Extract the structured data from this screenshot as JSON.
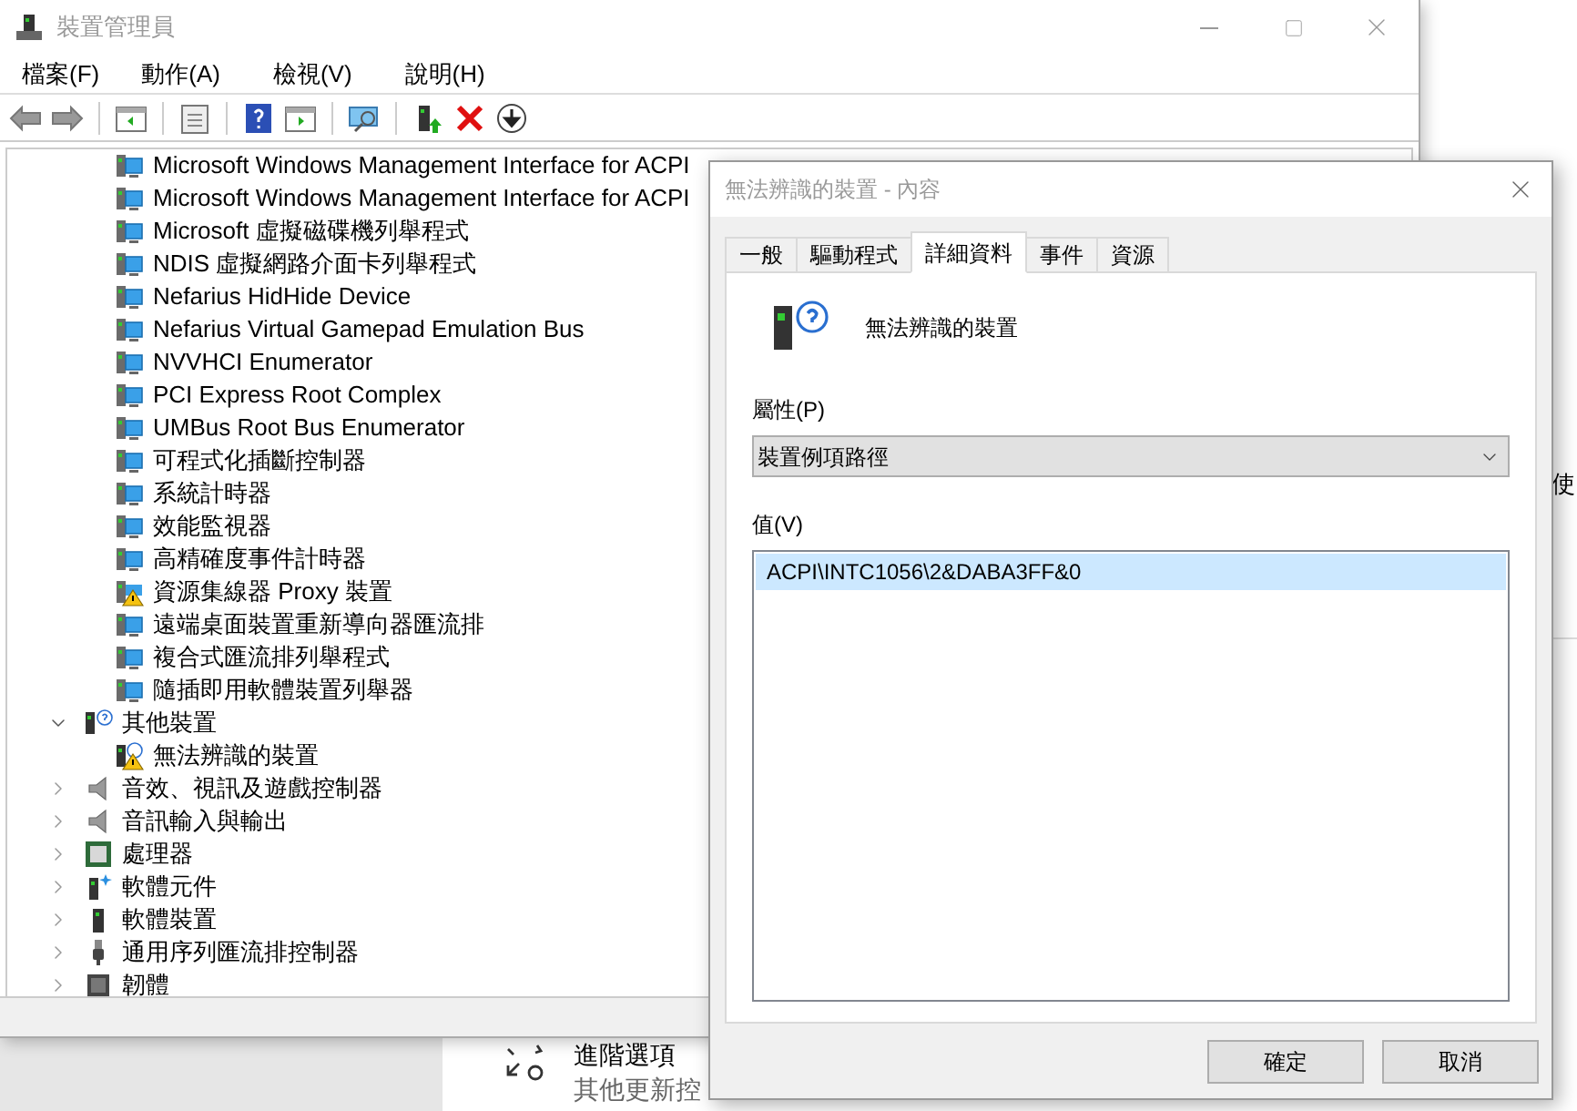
{
  "background_window": {
    "side_text": "使",
    "advanced_options": {
      "title": "進階選項",
      "subtitle": "其他更新控"
    }
  },
  "main_window": {
    "title": "裝置管理員",
    "menu": [
      "檔案(F)",
      "動作(A)",
      "檢視(V)",
      "說明(H)"
    ],
    "tree_partial_children": [
      {
        "label": "Microsoft Windows Management Interface for ACPI",
        "kind": "system"
      },
      {
        "label": "Microsoft Windows Management Interface for ACPI",
        "kind": "system"
      },
      {
        "label": "Microsoft 虛擬磁碟機列舉程式",
        "kind": "system"
      },
      {
        "label": "NDIS 虛擬網路介面卡列舉程式",
        "kind": "system"
      },
      {
        "label": "Nefarius HidHide Device",
        "kind": "system"
      },
      {
        "label": "Nefarius Virtual Gamepad Emulation Bus",
        "kind": "system"
      },
      {
        "label": "NVVHCI Enumerator",
        "kind": "system"
      },
      {
        "label": "PCI Express Root Complex",
        "kind": "system"
      },
      {
        "label": "UMBus Root Bus Enumerator",
        "kind": "system"
      },
      {
        "label": "可程式化插斷控制器",
        "kind": "system"
      },
      {
        "label": "系統計時器",
        "kind": "system"
      },
      {
        "label": "效能監視器",
        "kind": "system"
      },
      {
        "label": "高精確度事件計時器",
        "kind": "system"
      },
      {
        "label": "資源集線器 Proxy 裝置",
        "kind": "warning"
      },
      {
        "label": "遠端桌面裝置重新導向器匯流排",
        "kind": "system"
      },
      {
        "label": "複合式匯流排列舉程式",
        "kind": "system"
      },
      {
        "label": "隨插即用軟體裝置列舉器",
        "kind": "system"
      }
    ],
    "tree": [
      {
        "label": "其他裝置",
        "kind": "unknown",
        "expanded": true,
        "children": [
          {
            "label": "無法辨識的裝置",
            "kind": "warning-unknown"
          }
        ]
      },
      {
        "label": "音效、視訊及遊戲控制器",
        "kind": "speaker",
        "expanded": false
      },
      {
        "label": "音訊輸入與輸出",
        "kind": "speaker",
        "expanded": false
      },
      {
        "label": "處理器",
        "kind": "processor",
        "expanded": false
      },
      {
        "label": "軟體元件",
        "kind": "software-component",
        "expanded": false
      },
      {
        "label": "軟體裝置",
        "kind": "software-device",
        "expanded": false
      },
      {
        "label": "通用序列匯流排控制器",
        "kind": "usb",
        "expanded": false
      },
      {
        "label": "韌體",
        "kind": "firmware",
        "expanded": false
      }
    ]
  },
  "properties_dialog": {
    "title": "無法辨識的裝置 - 內容",
    "tabs": [
      {
        "label": "一般",
        "selected": false
      },
      {
        "label": "驅動程式",
        "selected": false
      },
      {
        "label": "詳細資料",
        "selected": true
      },
      {
        "label": "事件",
        "selected": false
      },
      {
        "label": "資源",
        "selected": false
      }
    ],
    "device_name": "無法辨識的裝置",
    "property_label": "屬性(P)",
    "property_value": "裝置例項路徑",
    "value_label": "值(V)",
    "values": [
      {
        "text": "ACPI\\INTC1056\\2&DABA3FF&0",
        "selected": true
      }
    ],
    "buttons": [
      "確定",
      "取消"
    ]
  }
}
